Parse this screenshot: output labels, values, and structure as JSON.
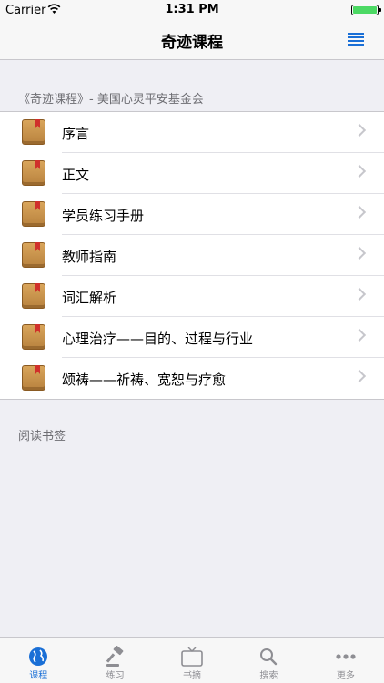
{
  "status_bar": {
    "carrier": "Carrier",
    "time": "1:31 PM"
  },
  "nav": {
    "title": "奇迹课程"
  },
  "section": {
    "header": "《奇迹课程》- 美国心灵平安基金会"
  },
  "list": {
    "items": [
      {
        "label": "序言"
      },
      {
        "label": "正文"
      },
      {
        "label": "学员练习手册"
      },
      {
        "label": "教师指南"
      },
      {
        "label": "词汇解析"
      },
      {
        "label": "心理治疗——目的、过程与行业"
      },
      {
        "label": "颂祷——祈祷、宽恕与疗愈"
      }
    ]
  },
  "bookmarks": {
    "header": "阅读书签"
  },
  "tabs": [
    {
      "label": "课程",
      "icon": "globe-icon"
    },
    {
      "label": "练习",
      "icon": "gavel-icon"
    },
    {
      "label": "书摘",
      "icon": "tv-icon"
    },
    {
      "label": "搜索",
      "icon": "search-icon"
    },
    {
      "label": "更多",
      "icon": "more-icon"
    }
  ],
  "colors": {
    "accent": "#1a6fd6",
    "background": "#efeff4",
    "book": "#c48a45",
    "bookmark_ribbon": "#d0302b"
  }
}
